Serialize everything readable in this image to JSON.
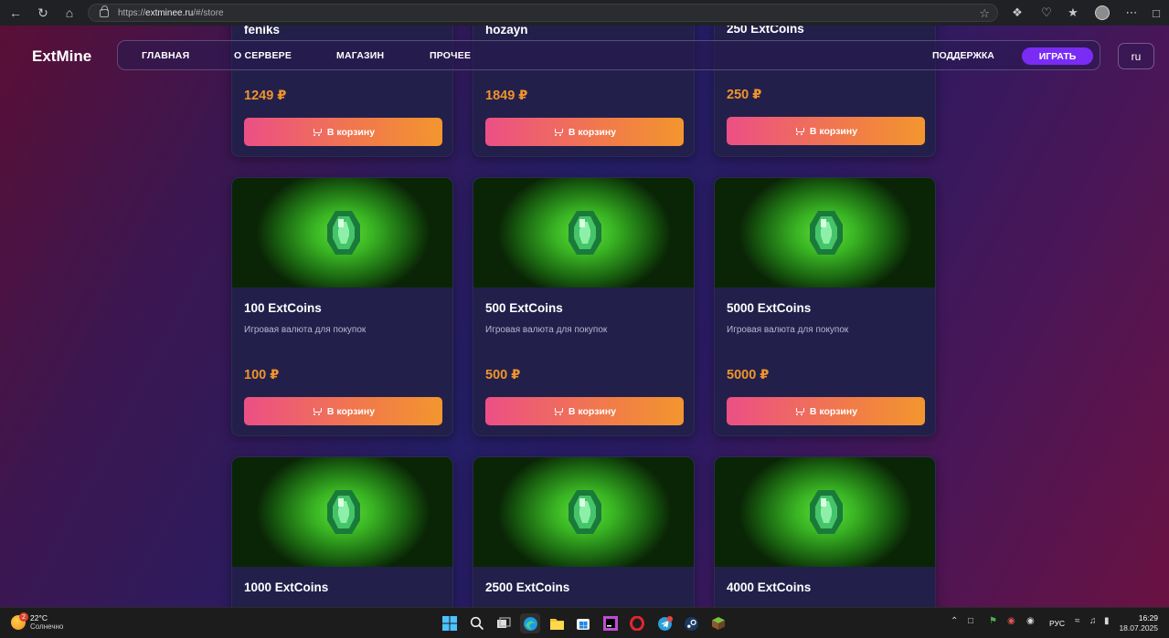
{
  "browser": {
    "url_prefix": "https://",
    "url_domain": "extminee.ru",
    "url_path": "/#/store"
  },
  "header": {
    "logo": "ExtMine",
    "nav": [
      "ГЛАВНАЯ",
      "О СЕРВЕРЕ",
      "МАГАЗИН",
      "ПРОЧЕЕ"
    ],
    "support": "ПОДДЕРЖКА",
    "play": "ИГРАТЬ",
    "lang": "ru"
  },
  "cart_label": "В корзину",
  "products_top": [
    {
      "title": "feniks",
      "price": "1249 ₽"
    },
    {
      "title": "hozayn",
      "price": "1849 ₽"
    },
    {
      "title": "250 ExtCoins",
      "price": "250 ₽"
    }
  ],
  "products": [
    {
      "title": "100 ExtCoins",
      "desc": "Игровая валюта для покупок",
      "price": "100 ₽"
    },
    {
      "title": "500 ExtCoins",
      "desc": "Игровая валюта для покупок",
      "price": "500 ₽"
    },
    {
      "title": "5000 ExtCoins",
      "desc": "Игровая валюта для покупок",
      "price": "5000 ₽"
    }
  ],
  "products_bottom": [
    {
      "title": "1000 ExtCoins"
    },
    {
      "title": "2500 ExtCoins"
    },
    {
      "title": "4000 ExtCoins"
    }
  ],
  "taskbar": {
    "weather_temp": "22°C",
    "weather_cond": "Солнечно",
    "weather_badge": "2",
    "lang": "РУС",
    "time": "16:29",
    "date": "18.07.2025"
  },
  "colors": {
    "accent_play": "#7a2cf5",
    "price": "#f0932b",
    "button_gradient_start": "#ec4f86",
    "button_gradient_end": "#f3962e"
  }
}
